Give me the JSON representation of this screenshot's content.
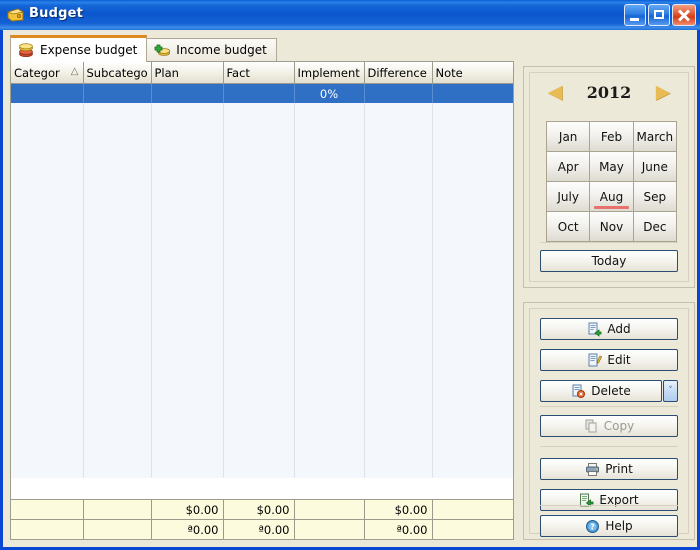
{
  "window": {
    "title": "Budget",
    "icon": "wallet-icon",
    "buttons": {
      "minimize": "Minimize",
      "maximize": "Restore",
      "close": "Close"
    },
    "colors": {
      "titlebar_blue": "#0b56cd",
      "client_beige": "#ece9d8",
      "selection_blue": "#2f6fc4",
      "tab_accent_orange": "#e08a1e",
      "total_row_yellow": "#fdfbdd",
      "month_underline_red": "#e8716e"
    }
  },
  "tabs": [
    {
      "label": "Expense budget",
      "icon": "expense-coins-icon",
      "active": true
    },
    {
      "label": "Income budget",
      "icon": "income-green-plus-icon",
      "active": false
    }
  ],
  "table": {
    "columns": [
      {
        "label": "Categor",
        "sorted": "ascending",
        "sort_icon": "sort-ascending-icon"
      },
      {
        "label": "Subcatego"
      },
      {
        "label": "Plan"
      },
      {
        "label": "Fact"
      },
      {
        "label": "Implement"
      },
      {
        "label": "Difference"
      },
      {
        "label": "Note"
      }
    ],
    "selected_row": [
      "",
      "",
      "",
      "",
      "0%",
      "",
      ""
    ],
    "totals": [
      [
        "",
        "",
        "$0.00",
        "$0.00",
        "",
        "$0.00",
        ""
      ],
      [
        "",
        "",
        "ª0.00",
        "ª0.00",
        "",
        "ª0.00",
        ""
      ]
    ]
  },
  "calendar": {
    "year": "2012",
    "prev_year": "◀",
    "next_year": "▶",
    "months": [
      {
        "label": "Jan"
      },
      {
        "label": "Feb"
      },
      {
        "label": "March"
      },
      {
        "label": "Apr"
      },
      {
        "label": "May"
      },
      {
        "label": "June"
      },
      {
        "label": "July"
      },
      {
        "label": "Aug",
        "selected": true
      },
      {
        "label": "Sep"
      },
      {
        "label": "Oct"
      },
      {
        "label": "Nov"
      },
      {
        "label": "Dec"
      }
    ],
    "today_label": "Today"
  },
  "actions": {
    "add": {
      "label": "Add",
      "icon": "add-document-icon",
      "enabled": true
    },
    "edit": {
      "label": "Edit",
      "icon": "edit-pencil-icon",
      "enabled": true
    },
    "delete": {
      "label": "Delete",
      "icon": "delete-document-icon",
      "enabled": true,
      "dropdown": "˅"
    },
    "copy": {
      "label": "Copy",
      "icon": "copy-icon",
      "enabled": false
    },
    "print": {
      "label": "Print",
      "icon": "printer-icon",
      "enabled": true
    },
    "export": {
      "label": "Export",
      "icon": "export-icon",
      "enabled": true
    },
    "help": {
      "label": "Help",
      "icon": "help-question-icon",
      "enabled": true
    }
  }
}
